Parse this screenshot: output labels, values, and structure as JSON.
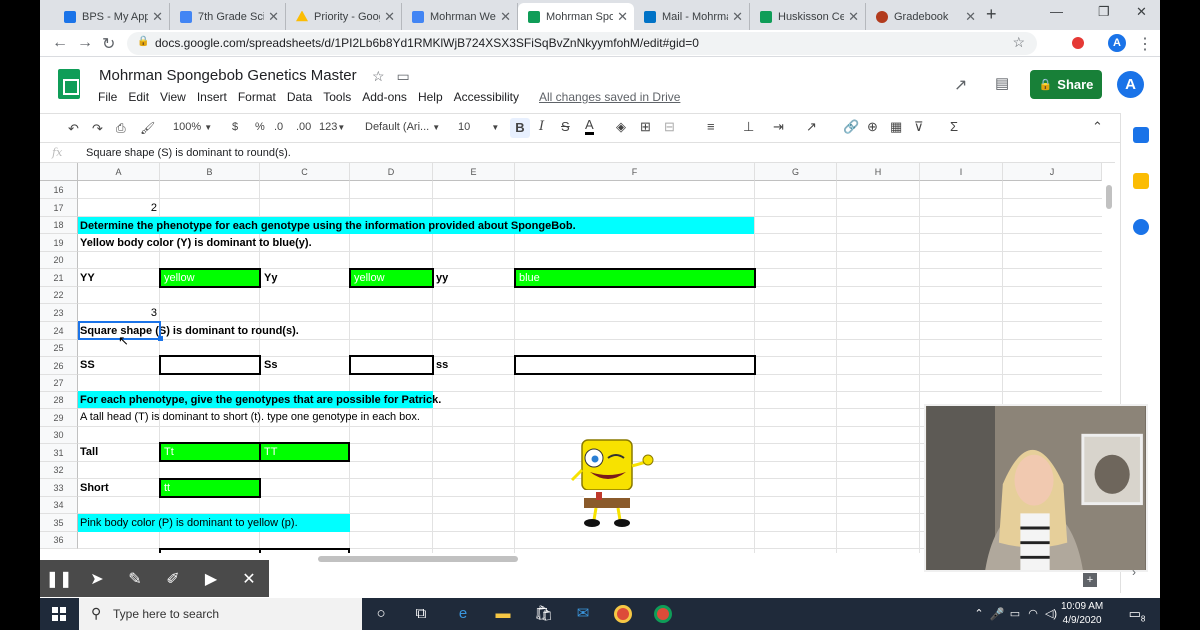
{
  "browser": {
    "tabs": [
      {
        "title": "BPS - My Apps",
        "color": "#1a73e8"
      },
      {
        "title": "7th Grade Scie",
        "color": "#4285f4"
      },
      {
        "title": "Priority - Goog",
        "color": "#fbbc04"
      },
      {
        "title": "Mohrman Wee",
        "color": "#4285f4"
      },
      {
        "title": "Mohrman Spo",
        "color": "#0f9d58",
        "active": true
      },
      {
        "title": "Mail - Mohrma",
        "color": "#0072c6"
      },
      {
        "title": "Huskisson Cele",
        "color": "#0f9d58"
      },
      {
        "title": "Gradebook",
        "color": "#b23b1e"
      }
    ],
    "url": "docs.google.com/spreadsheets/d/1PI2Lb6b8Yd1RMKlWjB724XSX3SFiSqBvZnNkyymfohM/edit#gid=0",
    "profile_initial": "A"
  },
  "sheet": {
    "title": "Mohrman Spongebob Genetics Master",
    "menu": [
      "File",
      "Edit",
      "View",
      "Insert",
      "Format",
      "Data",
      "Tools",
      "Add-ons",
      "Help",
      "Accessibility"
    ],
    "save_status": "All changes saved in Drive",
    "share_label": "Share",
    "user_initial": "A",
    "toolbar": {
      "zoom": "100%",
      "currency": "$",
      "percent": "%",
      "dec_less": ".0",
      "dec_more": ".00",
      "number_format": "123",
      "font": "Default (Ari...",
      "font_size": "10",
      "bold": "B",
      "italic": "I",
      "strike": "S",
      "text_color": "A"
    },
    "fx_label": "fx",
    "formula": "Square shape (S) is dominant to round(s).",
    "columns": [
      "A",
      "B",
      "C",
      "D",
      "E",
      "F",
      "G",
      "H",
      "I",
      "J"
    ],
    "rows": [
      "16",
      "17",
      "18",
      "19",
      "20",
      "21",
      "22",
      "23",
      "24",
      "25",
      "26",
      "27",
      "28",
      "29",
      "30",
      "31",
      "32",
      "33",
      "34",
      "35",
      "36"
    ],
    "cells": {
      "a17": "2",
      "r18": "Determine the phenotype for each genotype using the information provided about SpongeBob.",
      "r19": "Yellow body color (Y) is dominant to blue(y).",
      "a21": "YY",
      "b21": "yellow",
      "c21": "Yy",
      "d21": "yellow",
      "e21": "yy",
      "f21": "blue",
      "a23": "3",
      "r24": "Square shape (S) is dominant to round(s).",
      "a26": "SS",
      "c26": "Ss",
      "e26": "ss",
      "r28": "For each phenotype, give the genotypes that are possible for Patrick.",
      "r29": "A tall head (T) is dominant to short (t). type one genotype in each box.",
      "a31": "Tall",
      "b31": "Tt",
      "c31": "TT",
      "a33": "Short",
      "b33": "tt",
      "r35": "Pink body color (P) is dominant to yellow (p)."
    }
  },
  "taskbar": {
    "search_placeholder": "Type here to search",
    "time": "10:09 AM",
    "date": "4/9/2020",
    "notifications": "8"
  }
}
